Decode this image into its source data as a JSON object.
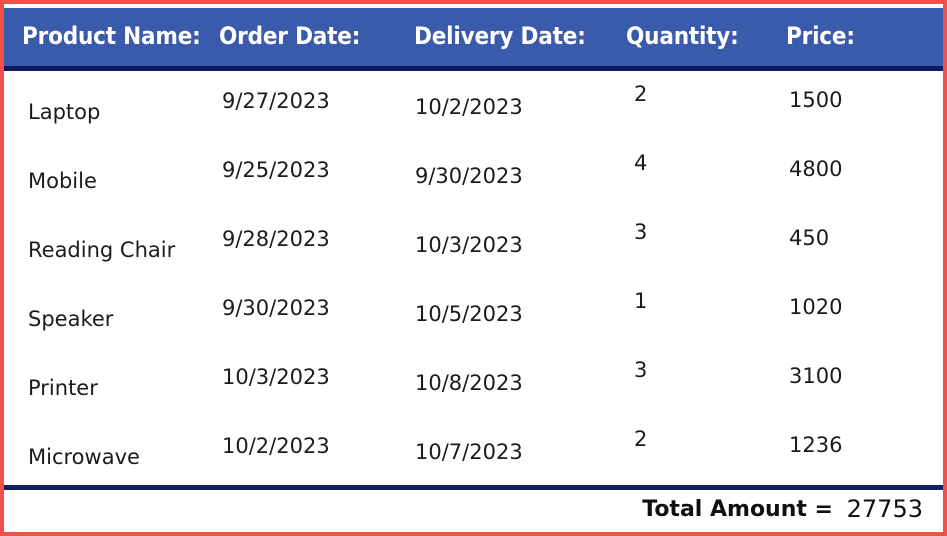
{
  "table": {
    "headers": [
      {
        "label": "Product Name:"
      },
      {
        "label": "Order Date:"
      },
      {
        "label": "Delivery Date:"
      },
      {
        "label": "Quantity:"
      },
      {
        "label": "Price:"
      }
    ],
    "rows": [
      {
        "product": "Laptop",
        "order_date": "9/27/2023",
        "delivery_date": "10/2/2023",
        "quantity": "2",
        "price": "1500"
      },
      {
        "product": "Mobile",
        "order_date": "9/25/2023",
        "delivery_date": "9/30/2023",
        "quantity": "4",
        "price": "4800"
      },
      {
        "product": "Reading Chair",
        "order_date": "9/28/2023",
        "delivery_date": "10/3/2023",
        "quantity": "3",
        "price": "450"
      },
      {
        "product": "Speaker",
        "order_date": "9/30/2023",
        "delivery_date": "10/5/2023",
        "quantity": "1",
        "price": "1020"
      },
      {
        "product": "Printer",
        "order_date": "10/3/2023",
        "delivery_date": "10/8/2023",
        "quantity": "3",
        "price": "3100"
      },
      {
        "product": "Microwave",
        "order_date": "10/2/2023",
        "delivery_date": "10/7/2023",
        "quantity": "2",
        "price": "1236"
      }
    ],
    "total": {
      "label": "Total Amount =",
      "value": "27753"
    }
  },
  "colors": {
    "header_background": "#3a5aab",
    "header_text": "#ffffff",
    "header_underline": "#0d1b5e",
    "outer_border": "#f0504c",
    "total_rule": "#13205e",
    "body_text": "#1b1b1b",
    "body_background": "#ffffff"
  }
}
